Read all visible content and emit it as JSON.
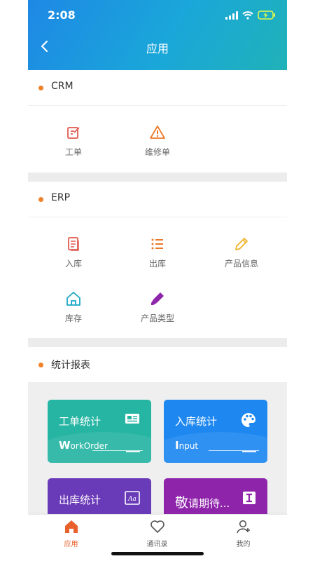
{
  "status": {
    "time": "2:08"
  },
  "header": {
    "title": "应用"
  },
  "sections": {
    "crm": {
      "title": "CRM",
      "items": [
        {
          "label": "工单",
          "icon": "edit-icon"
        },
        {
          "label": "维修单",
          "icon": "warning-icon"
        }
      ]
    },
    "erp": {
      "title": "ERP",
      "items": [
        {
          "label": "入库",
          "icon": "document-icon"
        },
        {
          "label": "出库",
          "icon": "list-icon"
        },
        {
          "label": "产品信息",
          "icon": "pencil-icon"
        },
        {
          "label": "库存",
          "icon": "home-icon"
        },
        {
          "label": "产品类型",
          "icon": "brush-icon"
        }
      ]
    },
    "reports": {
      "title": "统计报表",
      "cards": [
        {
          "title": "工单统计",
          "sub_first": "W",
          "sub_rest": "orkOrder",
          "icon": "id-card-icon",
          "color": "#26b5a3"
        },
        {
          "title": "入库统计",
          "sub_first": "I",
          "sub_rest": "nput",
          "icon": "palette-icon",
          "color": "#1e88f0"
        },
        {
          "title": "出库统计",
          "icon": "font-icon",
          "color": "#6a3bb8"
        },
        {
          "title_big": "敬",
          "title_rest": "请期待...",
          "icon": "text-cursor-icon",
          "color": "#8e24aa"
        }
      ]
    }
  },
  "tabbar": [
    {
      "label": "应用",
      "icon": "home-icon",
      "active": true,
      "color": "#e8612c"
    },
    {
      "label": "通讯录",
      "icon": "heart-icon",
      "active": false,
      "color": "#666666"
    },
    {
      "label": "我的",
      "icon": "user-icon",
      "active": false,
      "color": "#666666"
    }
  ]
}
